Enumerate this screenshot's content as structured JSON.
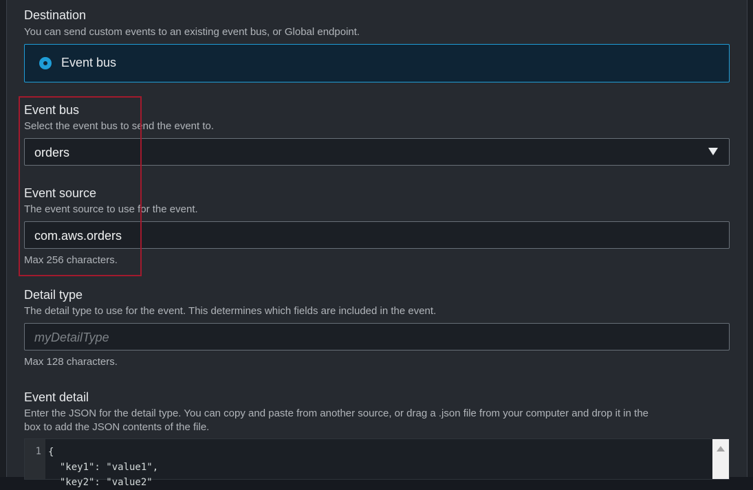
{
  "destination": {
    "label": "Destination",
    "description": "You can send custom events to an existing event bus, or Global endpoint.",
    "option": "Event bus"
  },
  "event_bus": {
    "label": "Event bus",
    "description": "Select the event bus to send the event to.",
    "value": "orders"
  },
  "event_source": {
    "label": "Event source",
    "description": "The event source to use for the event.",
    "value": "com.aws.orders",
    "hint": "Max 256 characters."
  },
  "detail_type": {
    "label": "Detail type",
    "description": "The detail type to use for the event. This determines which fields are included in the event.",
    "placeholder": "myDetailType",
    "hint": "Max 128 characters."
  },
  "event_detail": {
    "label": "Event detail",
    "description_line1": "Enter the JSON for the detail type. You can copy and paste from another source, or drag a .json file from your computer and drop it in the",
    "description_line2": "box to add the JSON contents of the file.",
    "line_number": "1",
    "code": "{\n  \"key1\": \"value1\",\n  \"key2\": \"value2\""
  },
  "colors": {
    "accent": "#1f9ed8",
    "highlight": "#a31a2d"
  }
}
